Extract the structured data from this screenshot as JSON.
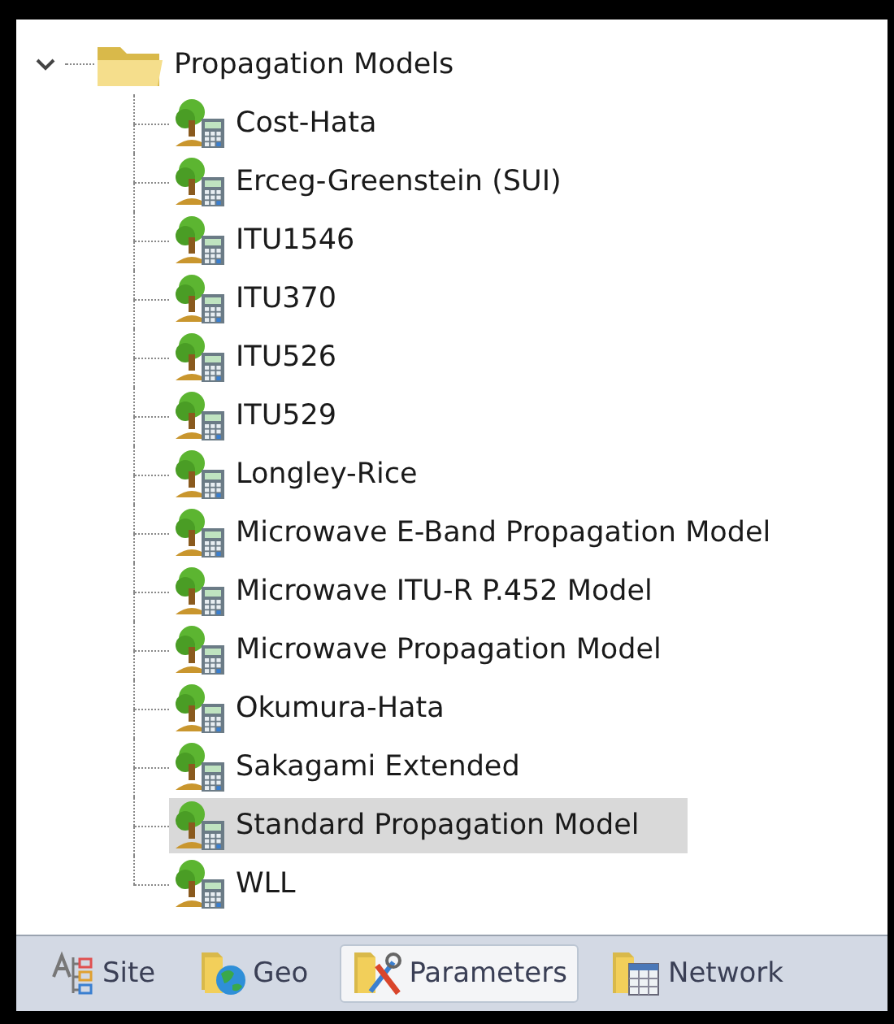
{
  "tree": {
    "label": "Propagation Models",
    "expanded": true,
    "children": [
      {
        "label": "Cost-Hata",
        "selected": false
      },
      {
        "label": "Erceg-Greenstein (SUI)",
        "selected": false
      },
      {
        "label": "ITU1546",
        "selected": false
      },
      {
        "label": "ITU370",
        "selected": false
      },
      {
        "label": "ITU526",
        "selected": false
      },
      {
        "label": "ITU529",
        "selected": false
      },
      {
        "label": "Longley-Rice",
        "selected": false
      },
      {
        "label": "Microwave E-Band Propagation Model",
        "selected": false
      },
      {
        "label": "Microwave ITU-R P.452 Model",
        "selected": false
      },
      {
        "label": "Microwave Propagation Model",
        "selected": false
      },
      {
        "label": "Okumura-Hata",
        "selected": false
      },
      {
        "label": "Sakagami Extended",
        "selected": false
      },
      {
        "label": "Standard Propagation Model",
        "selected": true
      },
      {
        "label": "WLL",
        "selected": false
      }
    ]
  },
  "tabs": [
    {
      "label": "Site",
      "kind": "site",
      "selected": false
    },
    {
      "label": "Geo",
      "kind": "geo",
      "selected": false
    },
    {
      "label": "Parameters",
      "kind": "parameters",
      "selected": true
    },
    {
      "label": "Network",
      "kind": "network",
      "selected": false
    }
  ]
}
